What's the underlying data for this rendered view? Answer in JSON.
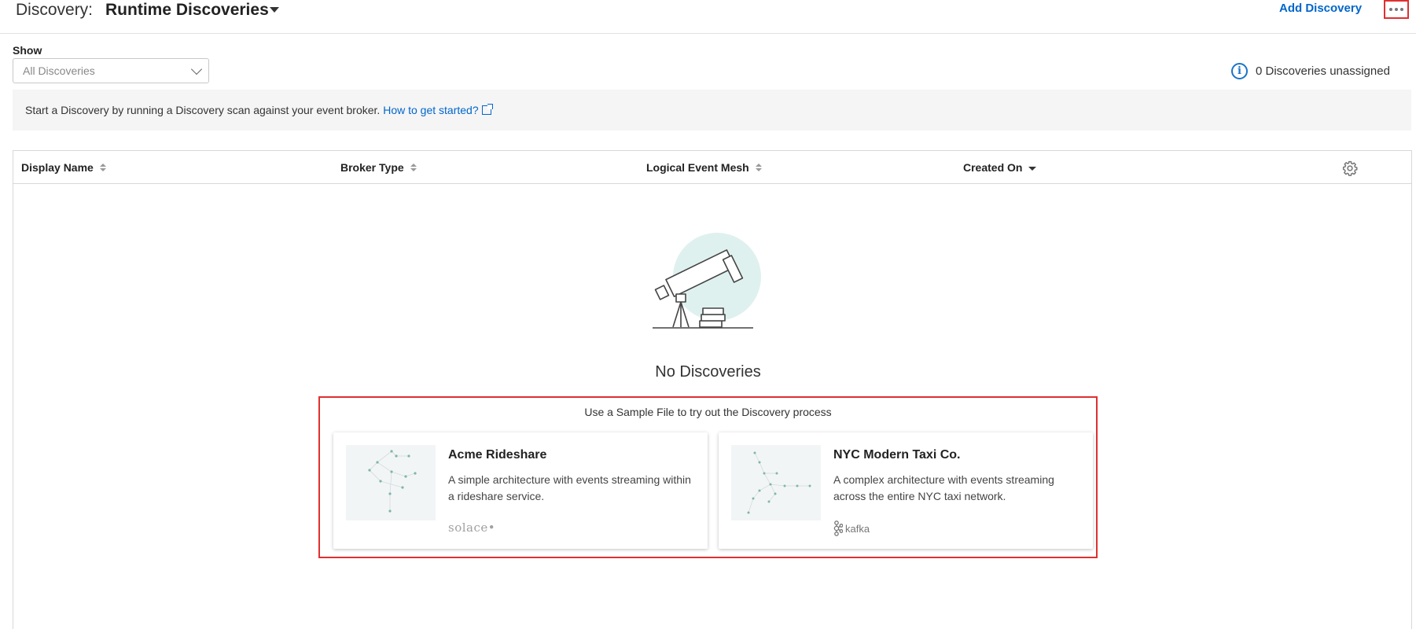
{
  "header": {
    "label": "Discovery:",
    "title": "Runtime Discoveries",
    "add_button": "Add Discovery"
  },
  "filter": {
    "label": "Show",
    "selected": "All Discoveries"
  },
  "status": {
    "unassigned_text": "0 Discoveries unassigned"
  },
  "banner": {
    "text": "Start a Discovery by running a Discovery scan against your event broker.",
    "link": "How to get started?"
  },
  "table": {
    "columns": [
      {
        "label": "Display Name",
        "sort": "none"
      },
      {
        "label": "Broker Type",
        "sort": "none"
      },
      {
        "label": "Logical Event Mesh",
        "sort": "none"
      },
      {
        "label": "Created On",
        "sort": "descending"
      }
    ]
  },
  "empty_state": {
    "title": "No Discoveries",
    "samples_title": "Use a Sample File to try out the Discovery process",
    "samples": [
      {
        "title": "Acme Rideshare",
        "description": "A simple architecture with events streaming within a rideshare service.",
        "logo_text": "solace",
        "logo_icon": "solace-logo"
      },
      {
        "title": "NYC Modern Taxi Co.",
        "description": "A complex architecture with events streaming across the entire NYC taxi network.",
        "logo_text": "kafka",
        "logo_icon": "kafka-logo"
      }
    ]
  },
  "colors": {
    "link": "#0066cc",
    "highlight": "#e03030",
    "accent_circle": "#dff1ef"
  }
}
